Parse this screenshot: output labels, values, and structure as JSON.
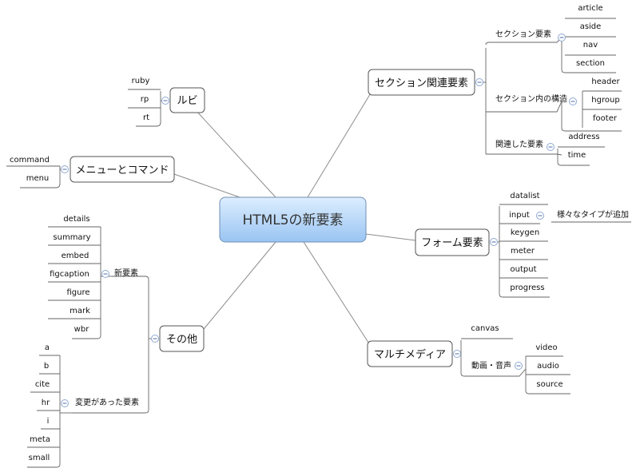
{
  "diagram": {
    "central": "HTML5の新要素",
    "topics": {
      "section": "セクション関連要素",
      "ruby": "ルビ",
      "menu": "メニューとコマンド",
      "form": "フォーム要素",
      "multimedia": "マルチメディア",
      "other": "その他"
    },
    "section": {
      "groups": [
        {
          "label": "セクション要素",
          "items": [
            "article",
            "aside",
            "nav",
            "section"
          ]
        },
        {
          "label": "セクション内の構造",
          "items": [
            "header",
            "hgroup",
            "footer"
          ]
        },
        {
          "label": "関連した要素",
          "items": [
            "address",
            "time"
          ]
        }
      ]
    },
    "ruby_items": [
      "ruby",
      "rp",
      "rt"
    ],
    "menu_items": [
      "command",
      "menu"
    ],
    "form": {
      "items": [
        "datalist",
        "input",
        "keygen",
        "meter",
        "output",
        "progress"
      ],
      "input_note": "様々なタイプが追加"
    },
    "multimedia": {
      "canvas": "canvas",
      "av_label": "動画・音声",
      "av_items": [
        "video",
        "audio",
        "source"
      ]
    },
    "other": {
      "new_label": "新要素",
      "new_items": [
        "details",
        "summary",
        "embed",
        "figcaption",
        "figure",
        "mark",
        "wbr"
      ],
      "changed_label": "変更があった要素",
      "changed_items": [
        "a",
        "b",
        "cite",
        "hr",
        "i",
        "meta",
        "small"
      ]
    }
  },
  "colors": {
    "central_top": "#ddeeff",
    "central_bottom": "#99c4f2",
    "central_border": "#6f8fb5",
    "collapse_blue": "#6b86b8"
  }
}
